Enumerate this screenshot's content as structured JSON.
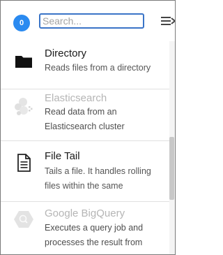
{
  "header": {
    "badge_count": "0",
    "search_placeholder": "Search..."
  },
  "items": [
    {
      "title": "Directory",
      "description": "Reads files from a directory",
      "icon": "folder-icon",
      "enabled": true
    },
    {
      "title": "Elasticsearch",
      "description": "Read data from an Elasticsearch cluster",
      "icon": "elasticsearch-icon",
      "enabled": false
    },
    {
      "title": "File Tail",
      "description": "Tails a file. It handles rolling files within the same",
      "icon": "file-icon",
      "enabled": true
    },
    {
      "title": "Google BigQuery",
      "description": "Executes a query job and processes the result from",
      "icon": "bigquery-icon",
      "enabled": false
    }
  ]
}
